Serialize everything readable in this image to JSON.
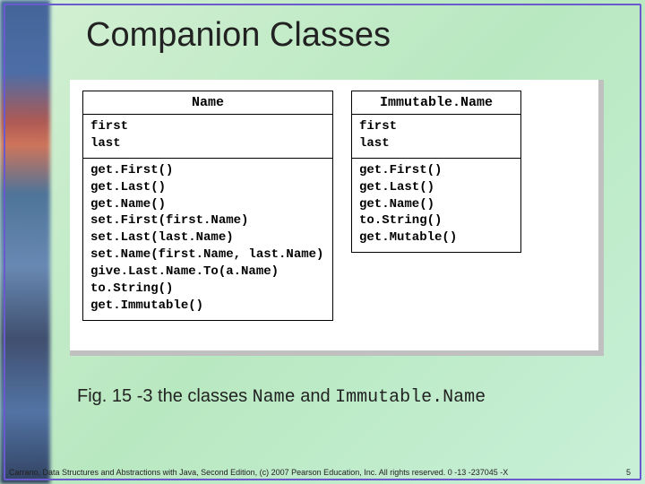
{
  "title": "Companion Classes",
  "umlA": {
    "name": "Name",
    "fields": "first\nlast",
    "methods": "get.First()\nget.Last()\nget.Name()\nset.First(first.Name)\nset.Last(last.Name)\nset.Name(first.Name, last.Name)\ngive.Last.Name.To(a.Name)\nto.String()\nget.Immutable()"
  },
  "umlB": {
    "name": "Immutable.Name",
    "fields": "first\nlast",
    "methods": "get.First()\nget.Last()\nget.Name()\nto.String()\nget.Mutable()"
  },
  "caption": {
    "prefix": "Fig. 15 -3 the classes ",
    "class1": "Name",
    "mid": " and ",
    "class2": "Immutable.Name"
  },
  "footer": {
    "text": "Carrano, Data Structures and Abstractions with Java, Second Edition, (c) 2007 Pearson Education, Inc. All rights reserved. 0 -13 -237045 -X",
    "page": "5"
  }
}
